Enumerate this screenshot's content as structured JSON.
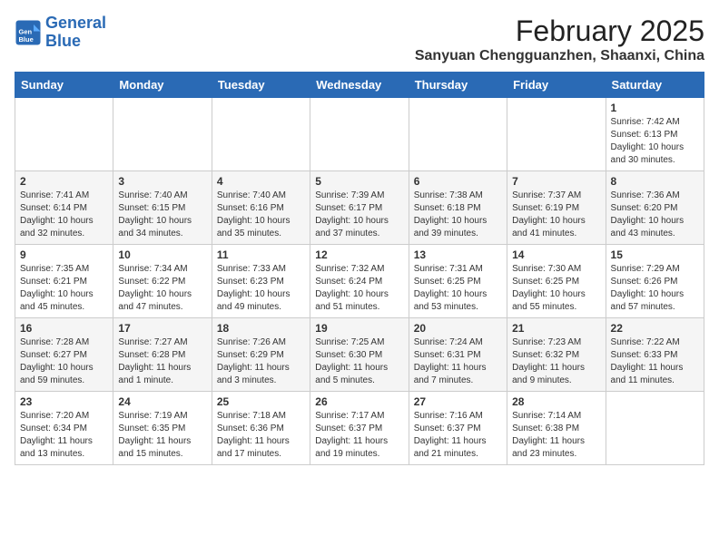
{
  "header": {
    "logo_line1": "General",
    "logo_line2": "Blue",
    "month": "February 2025",
    "location": "Sanyuan Chengguanzhen, Shaanxi, China"
  },
  "weekdays": [
    "Sunday",
    "Monday",
    "Tuesday",
    "Wednesday",
    "Thursday",
    "Friday",
    "Saturday"
  ],
  "weeks": [
    [
      {
        "day": "",
        "info": ""
      },
      {
        "day": "",
        "info": ""
      },
      {
        "day": "",
        "info": ""
      },
      {
        "day": "",
        "info": ""
      },
      {
        "day": "",
        "info": ""
      },
      {
        "day": "",
        "info": ""
      },
      {
        "day": "1",
        "info": "Sunrise: 7:42 AM\nSunset: 6:13 PM\nDaylight: 10 hours\nand 30 minutes."
      }
    ],
    [
      {
        "day": "2",
        "info": "Sunrise: 7:41 AM\nSunset: 6:14 PM\nDaylight: 10 hours\nand 32 minutes."
      },
      {
        "day": "3",
        "info": "Sunrise: 7:40 AM\nSunset: 6:15 PM\nDaylight: 10 hours\nand 34 minutes."
      },
      {
        "day": "4",
        "info": "Sunrise: 7:40 AM\nSunset: 6:16 PM\nDaylight: 10 hours\nand 35 minutes."
      },
      {
        "day": "5",
        "info": "Sunrise: 7:39 AM\nSunset: 6:17 PM\nDaylight: 10 hours\nand 37 minutes."
      },
      {
        "day": "6",
        "info": "Sunrise: 7:38 AM\nSunset: 6:18 PM\nDaylight: 10 hours\nand 39 minutes."
      },
      {
        "day": "7",
        "info": "Sunrise: 7:37 AM\nSunset: 6:19 PM\nDaylight: 10 hours\nand 41 minutes."
      },
      {
        "day": "8",
        "info": "Sunrise: 7:36 AM\nSunset: 6:20 PM\nDaylight: 10 hours\nand 43 minutes."
      }
    ],
    [
      {
        "day": "9",
        "info": "Sunrise: 7:35 AM\nSunset: 6:21 PM\nDaylight: 10 hours\nand 45 minutes."
      },
      {
        "day": "10",
        "info": "Sunrise: 7:34 AM\nSunset: 6:22 PM\nDaylight: 10 hours\nand 47 minutes."
      },
      {
        "day": "11",
        "info": "Sunrise: 7:33 AM\nSunset: 6:23 PM\nDaylight: 10 hours\nand 49 minutes."
      },
      {
        "day": "12",
        "info": "Sunrise: 7:32 AM\nSunset: 6:24 PM\nDaylight: 10 hours\nand 51 minutes."
      },
      {
        "day": "13",
        "info": "Sunrise: 7:31 AM\nSunset: 6:25 PM\nDaylight: 10 hours\nand 53 minutes."
      },
      {
        "day": "14",
        "info": "Sunrise: 7:30 AM\nSunset: 6:25 PM\nDaylight: 10 hours\nand 55 minutes."
      },
      {
        "day": "15",
        "info": "Sunrise: 7:29 AM\nSunset: 6:26 PM\nDaylight: 10 hours\nand 57 minutes."
      }
    ],
    [
      {
        "day": "16",
        "info": "Sunrise: 7:28 AM\nSunset: 6:27 PM\nDaylight: 10 hours\nand 59 minutes."
      },
      {
        "day": "17",
        "info": "Sunrise: 7:27 AM\nSunset: 6:28 PM\nDaylight: 11 hours\nand 1 minute."
      },
      {
        "day": "18",
        "info": "Sunrise: 7:26 AM\nSunset: 6:29 PM\nDaylight: 11 hours\nand 3 minutes."
      },
      {
        "day": "19",
        "info": "Sunrise: 7:25 AM\nSunset: 6:30 PM\nDaylight: 11 hours\nand 5 minutes."
      },
      {
        "day": "20",
        "info": "Sunrise: 7:24 AM\nSunset: 6:31 PM\nDaylight: 11 hours\nand 7 minutes."
      },
      {
        "day": "21",
        "info": "Sunrise: 7:23 AM\nSunset: 6:32 PM\nDaylight: 11 hours\nand 9 minutes."
      },
      {
        "day": "22",
        "info": "Sunrise: 7:22 AM\nSunset: 6:33 PM\nDaylight: 11 hours\nand 11 minutes."
      }
    ],
    [
      {
        "day": "23",
        "info": "Sunrise: 7:20 AM\nSunset: 6:34 PM\nDaylight: 11 hours\nand 13 minutes."
      },
      {
        "day": "24",
        "info": "Sunrise: 7:19 AM\nSunset: 6:35 PM\nDaylight: 11 hours\nand 15 minutes."
      },
      {
        "day": "25",
        "info": "Sunrise: 7:18 AM\nSunset: 6:36 PM\nDaylight: 11 hours\nand 17 minutes."
      },
      {
        "day": "26",
        "info": "Sunrise: 7:17 AM\nSunset: 6:37 PM\nDaylight: 11 hours\nand 19 minutes."
      },
      {
        "day": "27",
        "info": "Sunrise: 7:16 AM\nSunset: 6:37 PM\nDaylight: 11 hours\nand 21 minutes."
      },
      {
        "day": "28",
        "info": "Sunrise: 7:14 AM\nSunset: 6:38 PM\nDaylight: 11 hours\nand 23 minutes."
      },
      {
        "day": "",
        "info": ""
      }
    ]
  ]
}
